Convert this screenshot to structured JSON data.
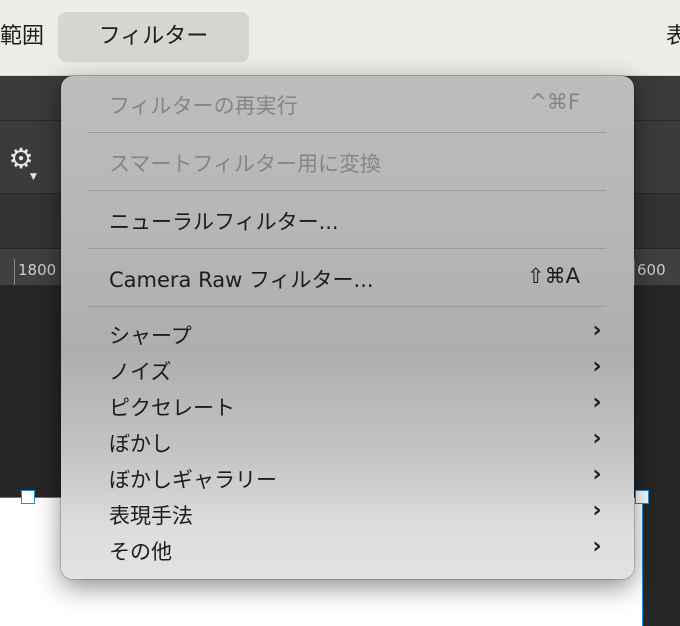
{
  "menubar": {
    "left_label": "範囲",
    "active_label": "フィルター",
    "right_label": "表"
  },
  "toolbar": {
    "gear_icon": "gear-icon"
  },
  "ruler": {
    "left_label": "1800",
    "right_label": "600"
  },
  "filter_menu": {
    "repeat_filter": {
      "label": "フィルターの再実行",
      "shortcut": "^⌘F",
      "enabled": false
    },
    "smart_filter": {
      "label": "スマートフィルター用に変換",
      "enabled": false
    },
    "neural_filter": {
      "label": "ニューラルフィルター..."
    },
    "camera_raw": {
      "label": "Camera Raw フィルター...",
      "shortcut": "⇧⌘A"
    },
    "submenus": [
      {
        "label": "シャープ"
      },
      {
        "label": "ノイズ"
      },
      {
        "label": "ピクセレート"
      },
      {
        "label": "ぼかし"
      },
      {
        "label": "ぼかしギャラリー"
      },
      {
        "label": "表現手法"
      },
      {
        "label": "その他"
      }
    ],
    "chevron_glyph": "›"
  }
}
